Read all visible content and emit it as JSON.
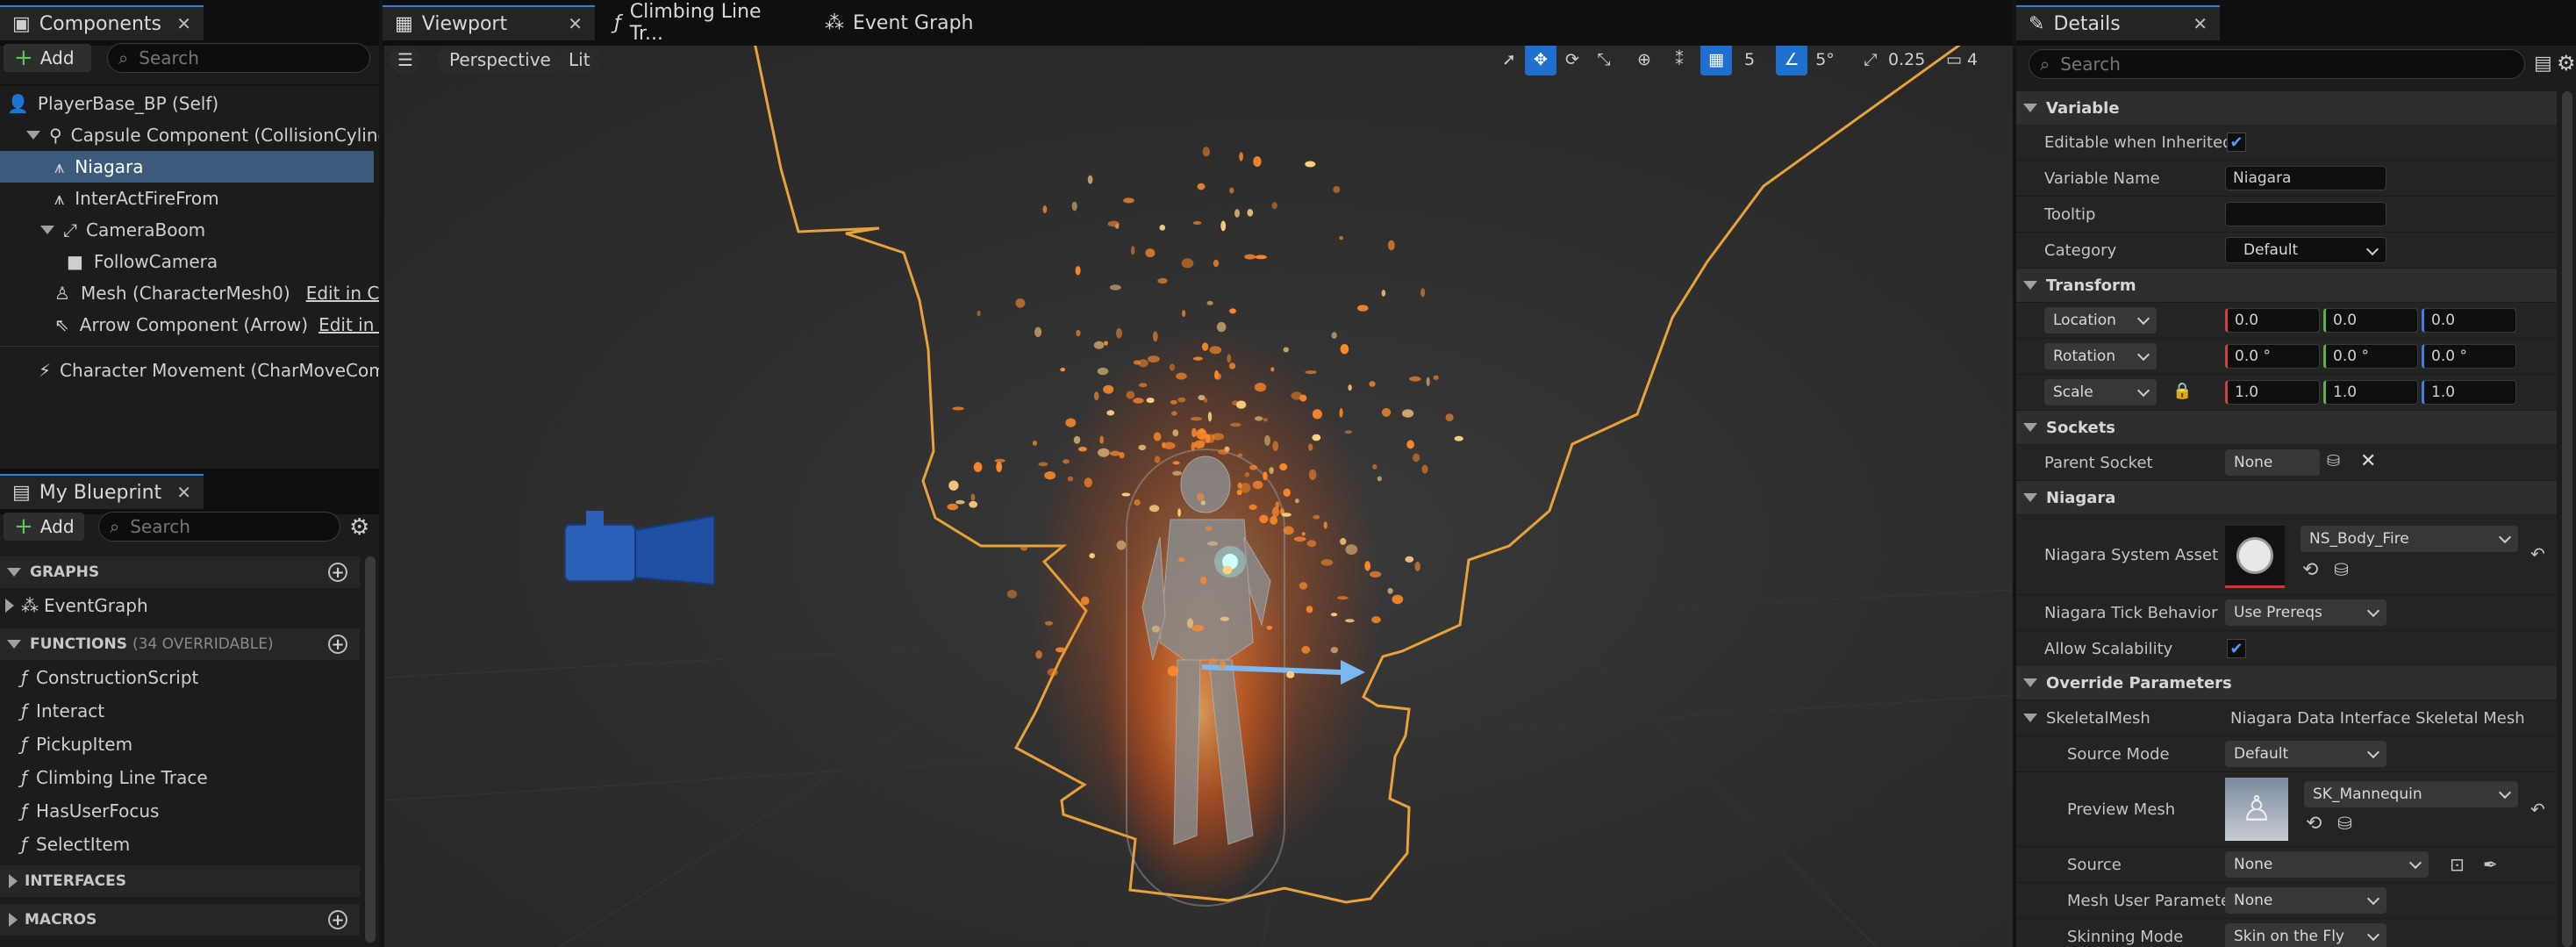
{
  "components": {
    "tab_label": "Components",
    "add_label": "Add",
    "search_placeholder": "Search",
    "tree": [
      {
        "label": "PlayerBase_BP (Self)"
      },
      {
        "label": "Capsule Component (CollisionCylinder)"
      },
      {
        "label": "Niagara"
      },
      {
        "label": "InterActFireFrom"
      },
      {
        "label": "CameraBoom"
      },
      {
        "label": "FollowCamera"
      },
      {
        "label": "Mesh (CharacterMesh0)",
        "link": "Edit in C++"
      },
      {
        "label": "Arrow Component (Arrow)",
        "link": "Edit in C++"
      },
      {
        "label": "Character Movement (CharMoveComp)"
      }
    ]
  },
  "blueprint": {
    "tab_label": "My Blueprint",
    "add_label": "Add",
    "search_placeholder": "Search",
    "graphs_header": "GRAPHS",
    "event_graph": "EventGraph",
    "functions_header": "FUNCTIONS",
    "functions_count": "(34 OVERRIDABLE)",
    "functions": [
      "ConstructionScript",
      "Interact",
      "PickupItem",
      "Climbing Line Trace",
      "HasUserFocus",
      "SelectItem"
    ],
    "interfaces_header": "INTERFACES",
    "macros_header": "MACROS"
  },
  "center_tabs": [
    "Viewport",
    "Climbing Line Tr...",
    "Event Graph"
  ],
  "viewport": {
    "perspective": "Perspective",
    "lit": "Lit",
    "grid_value": "5",
    "angle_value": "5°",
    "scale_value": "0.25",
    "camera_speed": "4"
  },
  "details": {
    "tab_label": "Details",
    "search_placeholder": "Search",
    "variable": {
      "header": "Variable",
      "editable_label": "Editable when Inherited",
      "editable_checked": true,
      "name_label": "Variable Name",
      "name_value": "Niagara",
      "tooltip_label": "Tooltip",
      "tooltip_value": "",
      "category_label": "Category",
      "category_value": "Default"
    },
    "transform": {
      "header": "Transform",
      "location_label": "Location",
      "location": [
        "0.0",
        "0.0",
        "0.0"
      ],
      "rotation_label": "Rotation",
      "rotation": [
        "0.0 °",
        "0.0 °",
        "0.0 °"
      ],
      "scale_label": "Scale",
      "scale": [
        "1.0",
        "1.0",
        "1.0"
      ]
    },
    "sockets": {
      "header": "Sockets",
      "parent_label": "Parent Socket",
      "parent_value": "None"
    },
    "niagara": {
      "header": "Niagara",
      "asset_label": "Niagara System Asset",
      "asset_value": "NS_Body_Fire",
      "tick_label": "Niagara Tick Behavior",
      "tick_value": "Use Prereqs",
      "scalability_label": "Allow Scalability",
      "scalability_checked": true
    },
    "override": {
      "header": "Override Parameters",
      "skeletal_label": "SkeletalMesh",
      "skeletal_value": "Niagara Data Interface Skeletal Mesh",
      "source_mode_label": "Source Mode",
      "source_mode_value": "Default",
      "preview_label": "Preview Mesh",
      "preview_value": "SK_Mannequin",
      "source_label": "Source",
      "source_value": "None",
      "mesh_user_label": "Mesh User Parameter",
      "mesh_user_value": "None",
      "skinning_label": "Skinning Mode",
      "skinning_value": "Skin on the Fly"
    }
  },
  "colors": {
    "selection": "#3b5a7c",
    "accent": "#1f6fcf",
    "outline": "#e8a23a",
    "fire": "#ff8a2a"
  }
}
